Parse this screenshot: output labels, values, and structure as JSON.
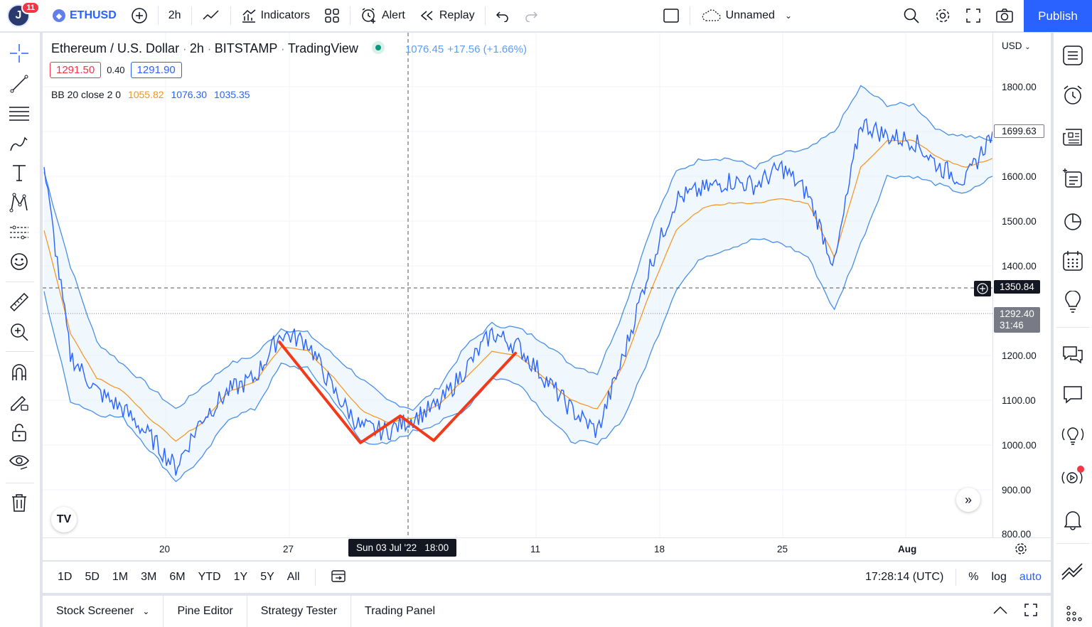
{
  "topbar": {
    "avatar_letter": "J",
    "notification_count": "11",
    "symbol": "ETHUSD",
    "interval": "2h",
    "indicators_label": "Indicators",
    "alert_label": "Alert",
    "replay_label": "Replay",
    "layout_name": "Unnamed",
    "publish_label": "Publish"
  },
  "legend": {
    "title": "Ethereum / U.S. Dollar",
    "interval": "2h",
    "exchange": "BITSTAMP",
    "source": "TradingView",
    "ohlc_value": "1076.45",
    "ohlc_change": "+17.56 (+1.66%)",
    "bid": "1291.50",
    "spread": "0.40",
    "ask": "1291.90",
    "indicator_name": "BB 20 close 2 0",
    "bb_basis": "1055.82",
    "bb_upper": "1076.30",
    "bb_lower": "1035.35"
  },
  "price_axis": {
    "currency": "USD",
    "ticks": [
      "1800.00",
      "1600.00",
      "1500.00",
      "1400.00",
      "1200.00",
      "1100.00",
      "1000.00",
      "900.00",
      "800.00"
    ],
    "last_price_label": "1699.63",
    "crosshair_price": "1350.84",
    "current_price": "1292.40",
    "countdown": "31:46"
  },
  "time_axis": {
    "ticks": [
      "20",
      "27",
      "11",
      "18",
      "25",
      "Aug"
    ],
    "crosshair_time": "Sun 03 Jul '22   18:00"
  },
  "bottom_bar": {
    "ranges": [
      "1D",
      "5D",
      "1M",
      "3M",
      "6M",
      "YTD",
      "1Y",
      "5Y",
      "All"
    ],
    "clock": "17:28:14 (UTC)",
    "percent_label": "%",
    "log_label": "log",
    "auto_label": "auto"
  },
  "panel": {
    "tabs": [
      "Stock Screener",
      "Pine Editor",
      "Strategy Tester",
      "Trading Panel"
    ]
  },
  "colors": {
    "accent": "#2962ff",
    "bb_basis": "#f7931a",
    "bb_band": "#4a8fe7",
    "price_line": "#2962ff",
    "annotation": "#f23a1a",
    "bid": "#f23645"
  },
  "chart_data": {
    "type": "line",
    "title": "Ethereum / U.S. Dollar · 2h · BITSTAMP",
    "xlabel": "",
    "ylabel": "USD",
    "ylim": [
      800,
      1850
    ],
    "x_ticks": [
      "20",
      "27",
      "Jul 3",
      "11",
      "18",
      "25",
      "Aug"
    ],
    "series": [
      {
        "name": "BB upper",
        "values": [
          1610,
          1400,
          1230,
          1180,
          1130,
          1080,
          1130,
          1180,
          1200,
          1260,
          1250,
          1200,
          1150,
          1100,
          1080,
          1130,
          1220,
          1270,
          1260,
          1230,
          1180,
          1160,
          1300,
          1480,
          1610,
          1640,
          1640,
          1620,
          1650,
          1660,
          1700,
          1800,
          1760,
          1760,
          1700,
          1690,
          1680
        ]
      },
      {
        "name": "BB basis",
        "values": [
          1480,
          1250,
          1150,
          1120,
          1060,
          1010,
          1050,
          1120,
          1140,
          1220,
          1210,
          1150,
          1080,
          1050,
          1060,
          1090,
          1150,
          1210,
          1200,
          1150,
          1100,
          1080,
          1180,
          1340,
          1480,
          1530,
          1540,
          1540,
          1550,
          1540,
          1420,
          1620,
          1680,
          1680,
          1640,
          1620,
          1640
        ]
      },
      {
        "name": "BB lower",
        "values": [
          1340,
          1100,
          1070,
          1060,
          990,
          920,
          970,
          1060,
          1080,
          1180,
          1170,
          1100,
          1010,
          1000,
          1030,
          1050,
          1080,
          1150,
          1140,
          1070,
          1010,
          1000,
          1060,
          1200,
          1350,
          1420,
          1440,
          1460,
          1450,
          1420,
          1300,
          1450,
          1600,
          1600,
          1580,
          1560,
          1600
        ]
      },
      {
        "name": "Price",
        "values": [
          1620,
          1200,
          1120,
          1080,
          1020,
          950,
          1060,
          1120,
          1150,
          1250,
          1230,
          1120,
          1040,
          1030,
          1060,
          1090,
          1170,
          1250,
          1220,
          1150,
          1080,
          1030,
          1200,
          1400,
          1550,
          1570,
          1590,
          1580,
          1620,
          1560,
          1400,
          1720,
          1690,
          1680,
          1620,
          1590,
          1700
        ]
      },
      {
        "name": "Drawing (W pattern)",
        "points": [
          [
            1230,
            "27"
          ],
          [
            1005,
            "Jul 1"
          ],
          [
            1065,
            "Jul 3"
          ],
          [
            1010,
            "Jul 4"
          ],
          [
            1205,
            "Jul 9"
          ]
        ]
      }
    ]
  }
}
